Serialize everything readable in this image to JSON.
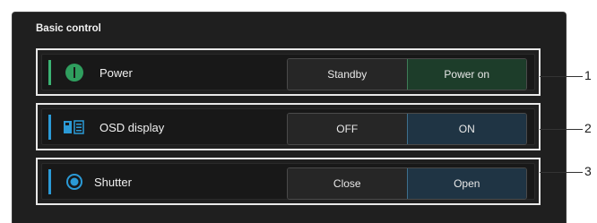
{
  "panel": {
    "title": "Basic control"
  },
  "rows": [
    {
      "label": "Power",
      "accent": "#3bb273",
      "icon": "power-icon",
      "buttons": [
        {
          "label": "Standby",
          "active": false
        },
        {
          "label": "Power on",
          "active": true
        }
      ]
    },
    {
      "label": "OSD display",
      "accent": "#2b9ad6",
      "icon": "osd-icon",
      "buttons": [
        {
          "label": "OFF",
          "active": false
        },
        {
          "label": "ON",
          "active": true
        }
      ]
    },
    {
      "label": "Shutter",
      "accent": "#2b9ad6",
      "icon": "shutter-icon",
      "buttons": [
        {
          "label": "Close",
          "active": false
        },
        {
          "label": "Open",
          "active": true
        }
      ]
    }
  ],
  "callouts": [
    "1",
    "2",
    "3"
  ],
  "colors": {
    "panel_bg": "#1f1f1f",
    "active_green": "#1d3d2a",
    "active_blue": "#1f3444"
  }
}
